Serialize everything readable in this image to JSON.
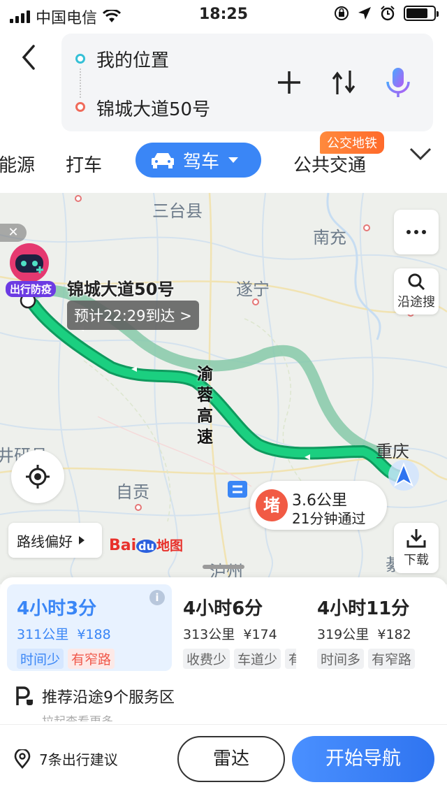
{
  "status_bar": {
    "carrier": "中国电信",
    "time": "18:25",
    "battery_level": 0.8
  },
  "header": {
    "back_icon": "chevron-left-icon",
    "origin": "我的位置",
    "destination": "锦城大道50号",
    "origin_color": "#35c0d6",
    "destination_color": "#f06b5b"
  },
  "mode_tabs": {
    "items": [
      "能源",
      "打车",
      "驾车",
      "公共交通"
    ],
    "active": "驾车",
    "badge": "公交地铁",
    "accent": "#3a86f6"
  },
  "map": {
    "cities": [
      "三台县",
      "南充",
      "遂宁",
      "重庆",
      "自贡",
      "泸州",
      "井研县",
      "綦江"
    ],
    "dest_label": "锦城大道50号",
    "eta": "预计22:29到达 >",
    "highway": "渝蓉高速",
    "covid_badge": "出行防疫",
    "more_icon": "more-icon",
    "search_along": "沿途搜",
    "download": "下载",
    "jam_badge": "堵",
    "jam_distance": "3.6公里",
    "jam_time": "21分钟通过",
    "route_pref": "路线偏好",
    "logo_text": "Baidu地图",
    "route_color": "#1bb574",
    "alt_route_color": "#86c9a9"
  },
  "plans": [
    {
      "time": "4小时3分",
      "distance": "311公里",
      "price": "¥188",
      "tags": [
        "时间少",
        "有窄路"
      ],
      "tag_colors": [
        "blue",
        "red"
      ],
      "selected": true
    },
    {
      "time": "4小时6分",
      "distance": "313公里",
      "price": "¥174",
      "tags": [
        "收费少",
        "车道少",
        "有窄"
      ],
      "tag_colors": [
        "gray",
        "gray",
        "gray"
      ],
      "selected": false
    },
    {
      "time": "4小时11分",
      "distance": "319公里",
      "price": "¥182",
      "tags": [
        "时间多",
        "有窄路"
      ],
      "tag_colors": [
        "gray",
        "gray"
      ],
      "selected": false
    }
  ],
  "service": "推荐沿途9个服务区",
  "pull_hint": "拉起查看更多",
  "bottom": {
    "advice": "7条出行建议",
    "radar": "雷达",
    "start": "开始导航"
  }
}
